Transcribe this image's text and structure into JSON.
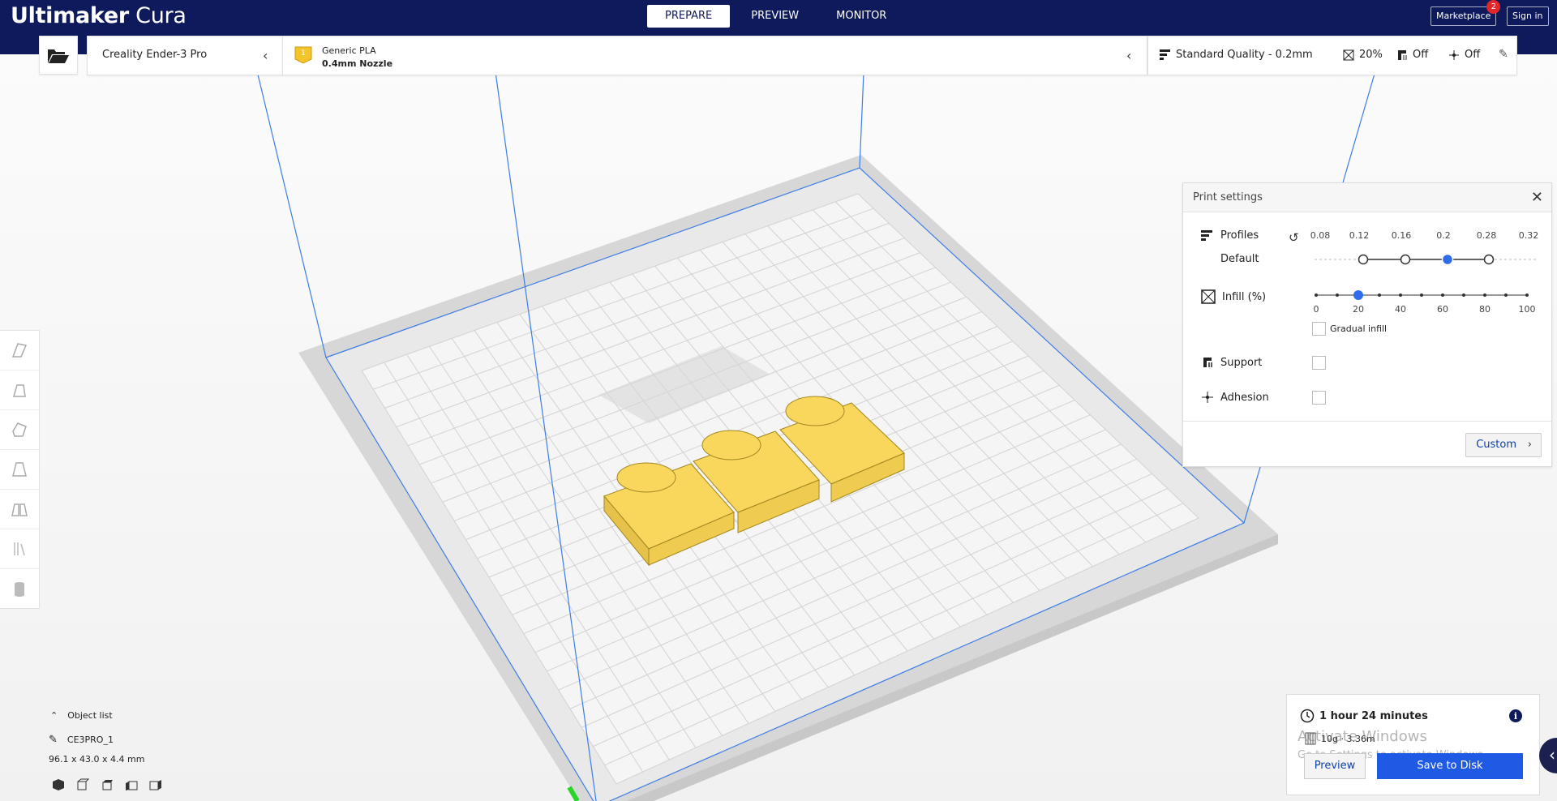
{
  "app": {
    "title_bold": "Ultimaker",
    "title_light": "Cura"
  },
  "stages": [
    "PREPARE",
    "PREVIEW",
    "MONITOR"
  ],
  "header": {
    "marketplace": "Marketplace",
    "marketplace_badge": "2",
    "signin": "Sign in"
  },
  "printer": {
    "name": "Creality Ender-3 Pro"
  },
  "material": {
    "slot": "1",
    "name": "Generic PLA",
    "nozzle": "0.4mm Nozzle",
    "color": "#f4c42a"
  },
  "quality_bar": {
    "profile": "Standard Quality - 0.2mm",
    "infill": "20%",
    "support": "Off",
    "adhesion": "Off"
  },
  "print_settings": {
    "title": "Print settings",
    "profiles_label": "Profiles",
    "profile_name": "Default",
    "layer_heights": [
      "0.08",
      "0.12",
      "0.16",
      "0.2",
      "0.28",
      "0.32"
    ],
    "selected_layer_height": "0.2",
    "infill_label": "Infill (%)",
    "infill_ticks": [
      "0",
      "20",
      "40",
      "60",
      "80",
      "100"
    ],
    "infill_value": 20,
    "gradual_infill_label": "Gradual infill",
    "gradual_infill": false,
    "support_label": "Support",
    "support": false,
    "adhesion_label": "Adhesion",
    "adhesion": false,
    "custom_label": "Custom"
  },
  "object_list": {
    "header": "Object list",
    "object_name": "CE3PRO_1",
    "dimensions": "96.1 x 43.0 x 4.4 mm"
  },
  "estimate": {
    "time": "1 hour 24 minutes",
    "material": "10g · 3.36m",
    "preview_label": "Preview",
    "save_label": "Save to Disk"
  },
  "watermark": {
    "line1": "Activate Windows",
    "line2": "Go to Settings to activate Windows."
  },
  "colors": {
    "header": "#0f1a5c",
    "accent": "#1f5ae4",
    "model": "#f9d65c",
    "slider_handle": "#2f6ee8"
  }
}
